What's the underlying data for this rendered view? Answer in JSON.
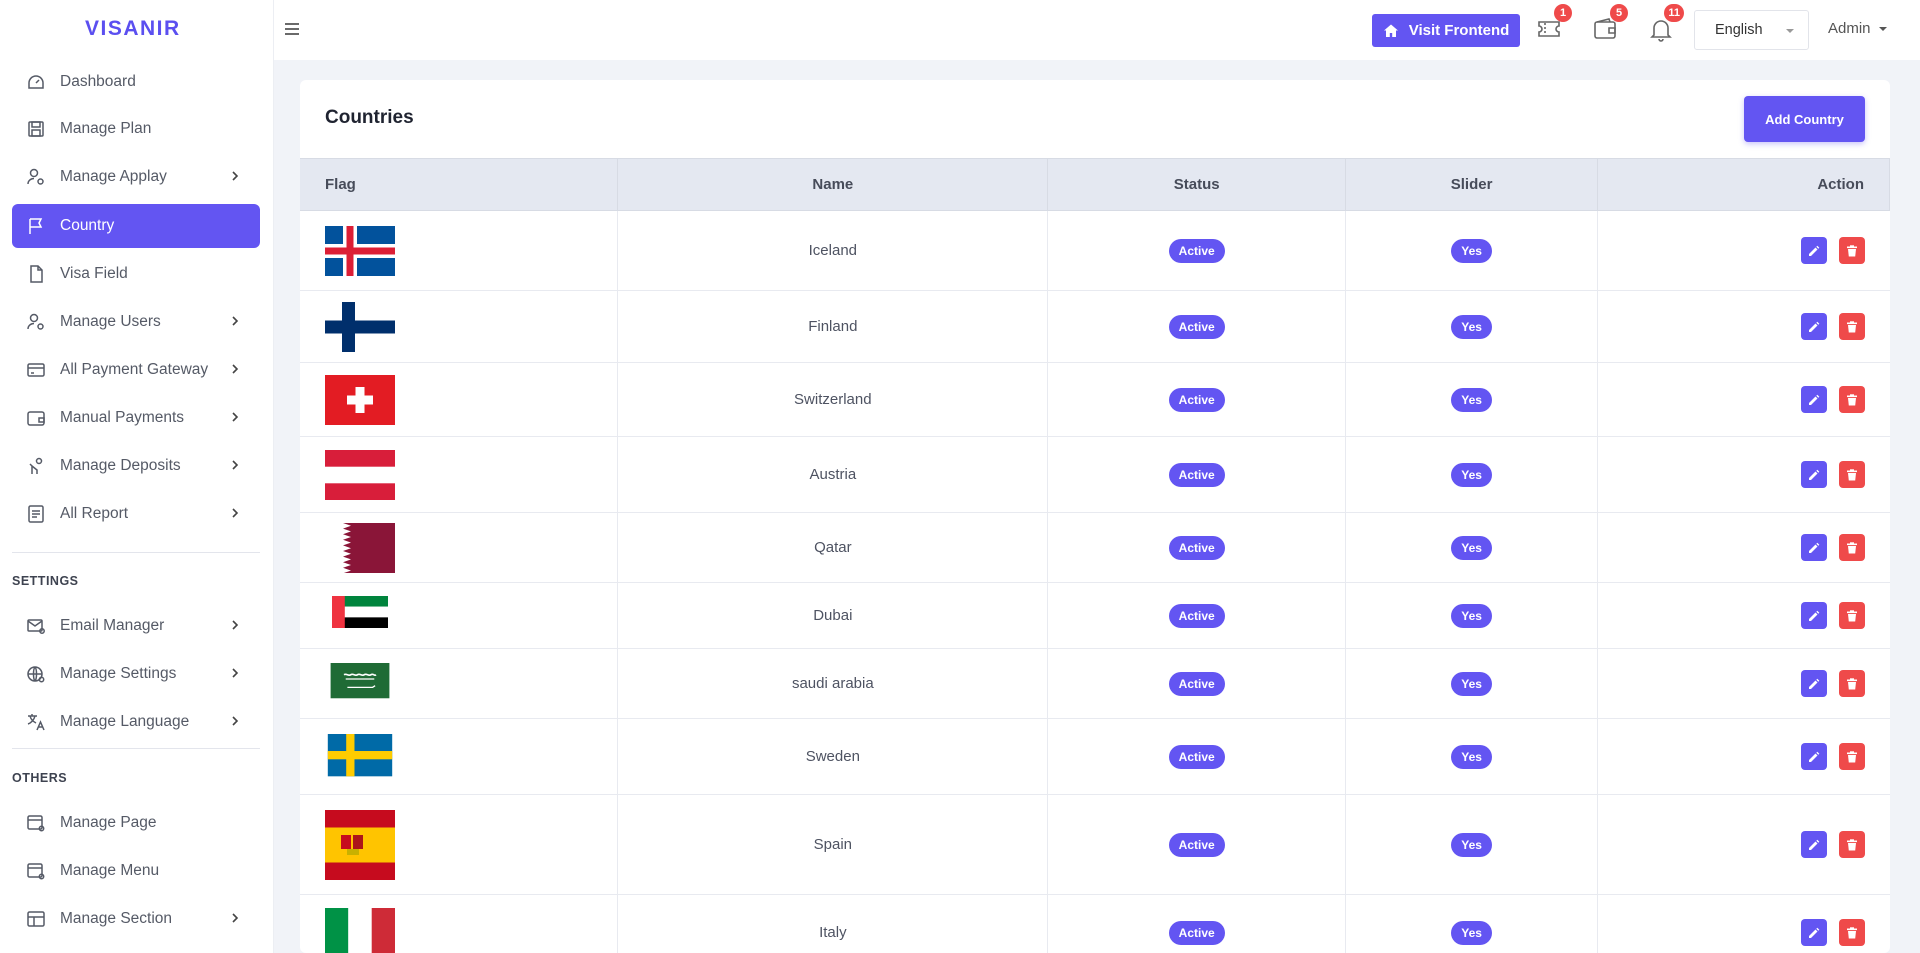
{
  "brand": "VISANIR",
  "topbar": {
    "visit_label": "Visit Frontend",
    "badges": {
      "tickets": "1",
      "wallet": "5",
      "notifications": "11"
    },
    "language": "English",
    "user": "Admin"
  },
  "sidebar": {
    "items": [
      {
        "label": "Dashboard",
        "icon": "dashboard-icon"
      },
      {
        "label": "Manage Plan",
        "icon": "save-icon"
      },
      {
        "label": "Manage Applay",
        "icon": "user-gear-icon"
      },
      {
        "label": "Country",
        "icon": "flag-icon"
      },
      {
        "label": "Visa Field",
        "icon": "file-icon"
      },
      {
        "label": "Manage Users",
        "icon": "user-gear-icon"
      },
      {
        "label": "All Payment Gateway",
        "icon": "credit-card-icon"
      },
      {
        "label": "Manual Payments",
        "icon": "wallet-icon"
      },
      {
        "label": "Manage Deposits",
        "icon": "hand-coin-icon"
      },
      {
        "label": "All Report",
        "icon": "report-icon"
      }
    ],
    "settings_label": "SETTINGS",
    "settings_items": [
      {
        "label": "Email Manager",
        "icon": "mail-gear-icon"
      },
      {
        "label": "Manage Settings",
        "icon": "settings-icon"
      },
      {
        "label": "Manage Language",
        "icon": "translate-icon"
      }
    ],
    "others_label": "OTHERS",
    "others_items": [
      {
        "label": "Manage Page",
        "icon": "page-gear-icon"
      },
      {
        "label": "Manage Menu",
        "icon": "menu-gear-icon"
      },
      {
        "label": "Manage Section",
        "icon": "layout-icon"
      }
    ]
  },
  "main": {
    "title": "Countries",
    "add_label": "Add Country",
    "columns": [
      "Flag",
      "Name",
      "Status",
      "Slider",
      "Action"
    ],
    "rows": [
      {
        "name": "Iceland",
        "status": "Active",
        "slider": "Yes",
        "flag": "iceland"
      },
      {
        "name": "Finland",
        "status": "Active",
        "slider": "Yes",
        "flag": "finland"
      },
      {
        "name": "Switzerland",
        "status": "Active",
        "slider": "Yes",
        "flag": "switzerland"
      },
      {
        "name": "Austria",
        "status": "Active",
        "slider": "Yes",
        "flag": "austria"
      },
      {
        "name": "Qatar",
        "status": "Active",
        "slider": "Yes",
        "flag": "qatar"
      },
      {
        "name": "Dubai",
        "status": "Active",
        "slider": "Yes",
        "flag": "uae"
      },
      {
        "name": "saudi arabia",
        "status": "Active",
        "slider": "Yes",
        "flag": "saudi"
      },
      {
        "name": "Sweden",
        "status": "Active",
        "slider": "Yes",
        "flag": "sweden"
      },
      {
        "name": "Spain",
        "status": "Active",
        "slider": "Yes",
        "flag": "spain"
      },
      {
        "name": "Italy",
        "status": "Active",
        "slider": "Yes",
        "flag": "italy"
      }
    ]
  },
  "colors": {
    "accent": "#6355f2",
    "danger": "#ef4a4a"
  }
}
